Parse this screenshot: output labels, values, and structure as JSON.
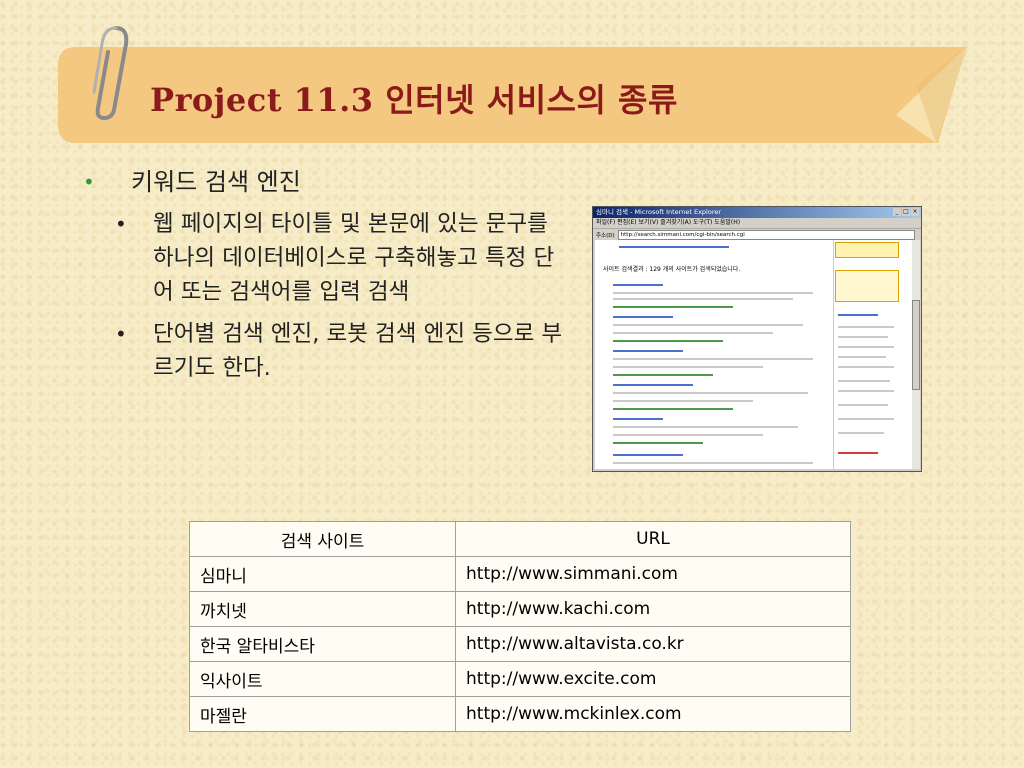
{
  "slide": {
    "title": "Project 11.3 인터넷 서비스의 종류",
    "colors": {
      "title": "#8b1a1a",
      "banner": "#f4c880",
      "bullet_green": "#3a9a2a"
    }
  },
  "bullets": {
    "level1": "키워드 검색 엔진",
    "level2": [
      "웹 페이지의 타이틀 및 본문에 있는 문구를 하나의 데이터베이스로 구축해놓고 특정 단어 또는 검색어를 입력 검색",
      "단어별 검색 엔진, 로봇 검색 엔진 등으로 부르기도 한다."
    ]
  },
  "screenshot": {
    "window_title": "심마니 검색 - Microsoft Internet Explorer",
    "menu": "파일(F)  편집(E)  보기(V)  즐겨찾기(A)  도구(T)  도움말(H)",
    "address_label": "주소(D)",
    "address": "http://search.simmani.com/cgi-bin/search.cgi",
    "result_heading": "사이트 검색결과 : 129 개의 사이트가 검색되었습니다."
  },
  "table": {
    "headers": [
      "검색 사이트",
      "URL"
    ],
    "rows": [
      [
        "심마니",
        "http://www.simmani.com"
      ],
      [
        "까치넷",
        "http://www.kachi.com"
      ],
      [
        "한국 알타비스타",
        "http://www.altavista.co.kr"
      ],
      [
        "익사이트",
        "http://www.excite.com"
      ],
      [
        "마젤란",
        "http://www.mckinlex.com"
      ]
    ]
  }
}
